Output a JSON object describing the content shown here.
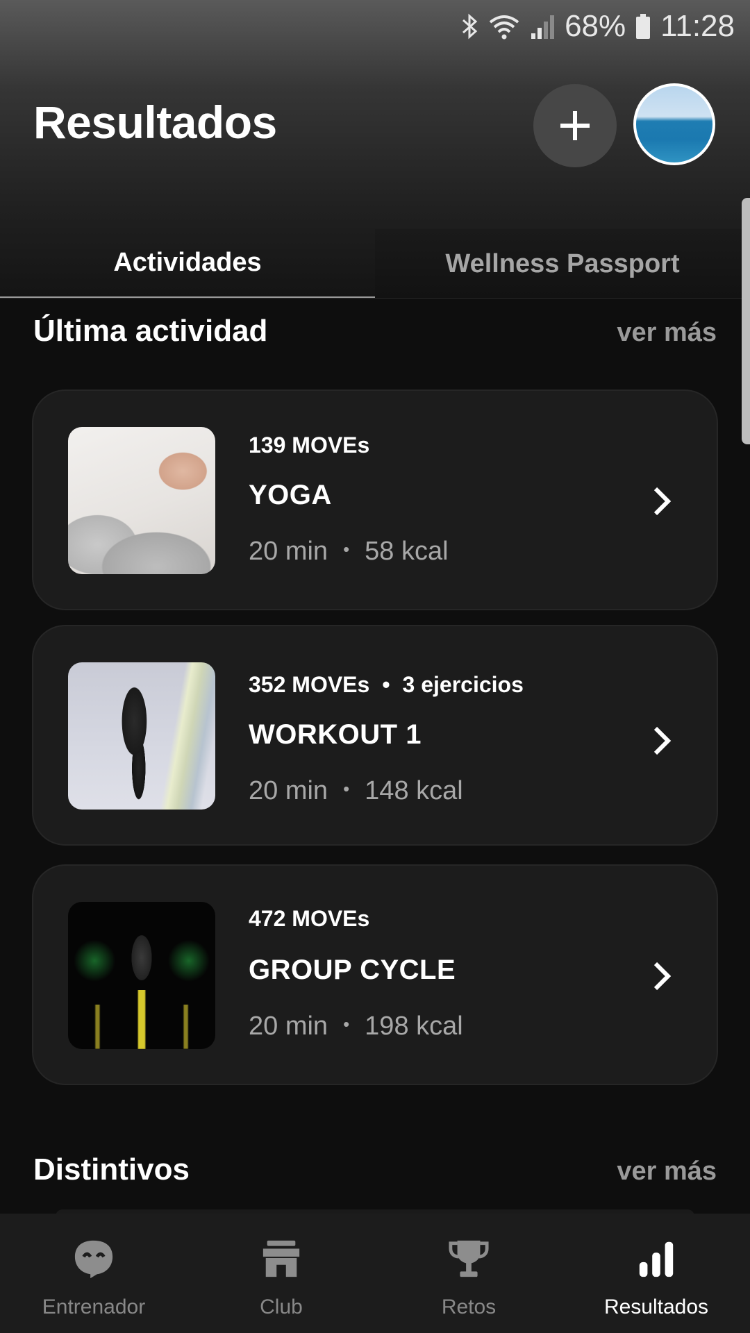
{
  "status_bar": {
    "battery": "68%",
    "time": "11:28"
  },
  "header": {
    "title": "Resultados"
  },
  "tabs": [
    {
      "label": "Actividades",
      "active": true
    },
    {
      "label": "Wellness Passport",
      "active": false
    }
  ],
  "latest": {
    "title": "Última actividad",
    "see_more": "ver más",
    "activities": [
      {
        "moves": "139 MOVEs",
        "extra": "",
        "name": "YOGA",
        "duration": "20 min",
        "kcal": "58 kcal"
      },
      {
        "moves": "352 MOVEs",
        "extra": "3 ejercicios",
        "name": "WORKOUT 1",
        "duration": "20 min",
        "kcal": "148 kcal"
      },
      {
        "moves": "472 MOVEs",
        "extra": "",
        "name": "GROUP CYCLE",
        "duration": "20 min",
        "kcal": "198 kcal"
      }
    ],
    "separator": "•"
  },
  "badges": {
    "title": "Distintivos",
    "see_more": "ver más"
  },
  "bottom_nav": [
    {
      "label": "Entrenador",
      "icon": "coach-face-icon",
      "active": false
    },
    {
      "label": "Club",
      "icon": "storefront-icon",
      "active": false
    },
    {
      "label": "Retos",
      "icon": "trophy-icon",
      "active": false
    },
    {
      "label": "Resultados",
      "icon": "bar-chart-icon",
      "active": true
    }
  ]
}
